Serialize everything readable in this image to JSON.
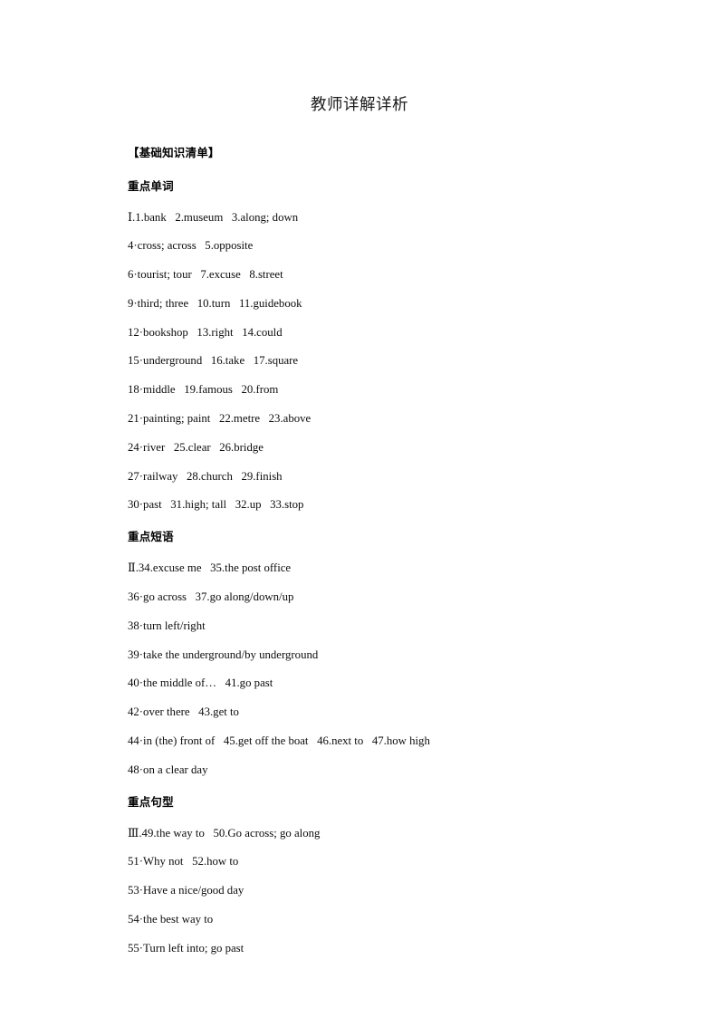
{
  "document": {
    "title": "教师详解详析",
    "knowledge_list_heading": "【基础知识清单】",
    "sections": [
      {
        "heading": "重点单词",
        "lines": [
          "Ⅰ.1.bank   2.museum   3.along; down",
          "4·cross; across   5.opposite",
          "6·tourist; tour   7.excuse   8.street",
          "9·third; three   10.turn   11.guidebook",
          "12·bookshop   13.right   14.could",
          "15·underground   16.take   17.square",
          "18·middle   19.famous   20.from",
          "21·painting; paint   22.metre   23.above",
          "24·river   25.clear   26.bridge",
          "27·railway   28.church   29.finish",
          "30·past   31.high; tall   32.up   33.stop"
        ]
      },
      {
        "heading": "重点短语",
        "lines": [
          "Ⅱ.34.excuse me   35.the post office",
          "36·go across   37.go along/down/up",
          "38·turn left/right",
          "39·take the underground/by underground",
          "40·the middle of…   41.go past",
          "42·over there   43.get to",
          "44·in (the) front of   45.get off the boat   46.next to   47.how high",
          "48·on a clear day"
        ]
      },
      {
        "heading": "重点句型",
        "lines": [
          "Ⅲ.49.the way to   50.Go across; go along",
          "51·Why not   52.how to",
          "53·Have a nice/good day",
          "54·the best way to",
          "55·Turn left into; go past"
        ]
      }
    ]
  }
}
